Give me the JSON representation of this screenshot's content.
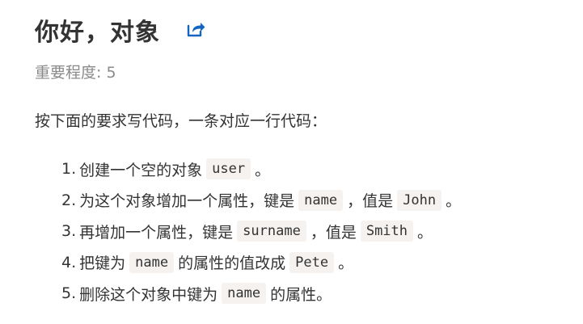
{
  "header": {
    "title": "你好，对象",
    "open_icon": "external-link-icon",
    "accent_color": "#1565c0"
  },
  "importance": {
    "text": "重要程度: 5"
  },
  "intro": {
    "text": "按下面的要求写代码，一条对应一行代码："
  },
  "tasks": [
    {
      "num": "1.",
      "t1": "创建一个空的对象",
      "c1": "user",
      "t2": "。"
    },
    {
      "num": "2.",
      "t1": "为这个对象增加一个属性，键是",
      "c1": "name",
      "t2": "，值是",
      "c2": "John",
      "t3": "。"
    },
    {
      "num": "3.",
      "t1": "再增加一个属性，键是",
      "c1": "surname",
      "t2": "，值是",
      "c2": "Smith",
      "t3": "。"
    },
    {
      "num": "4.",
      "t1": "把键为",
      "c1": "name",
      "t2": "的属性的值改成",
      "c2": "Pete",
      "t3": "。"
    },
    {
      "num": "5.",
      "t1": "删除这个对象中键为",
      "c1": "name",
      "t2": "的属性。"
    }
  ]
}
